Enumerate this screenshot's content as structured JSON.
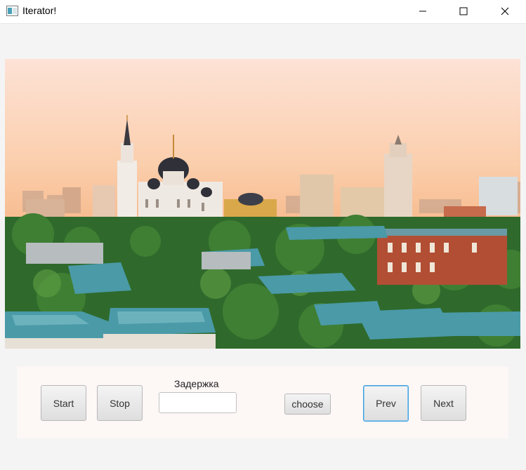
{
  "window": {
    "title": "Iterator!",
    "app_icon": "java-window-icon",
    "controls": [
      "minimize-icon",
      "maximize-icon",
      "close-icon"
    ]
  },
  "image": {
    "content": "city-skyline-photo"
  },
  "controls": {
    "start_label": "Start",
    "stop_label": "Stop",
    "delay_label": "Задержка",
    "delay_value": "",
    "choose_label": "choose",
    "prev_label": "Prev",
    "next_label": "Next"
  },
  "colors": {
    "focused_border": "#3d9fdc",
    "panel_background": "#fdf7f6",
    "window_background": "#f4f4f4"
  }
}
